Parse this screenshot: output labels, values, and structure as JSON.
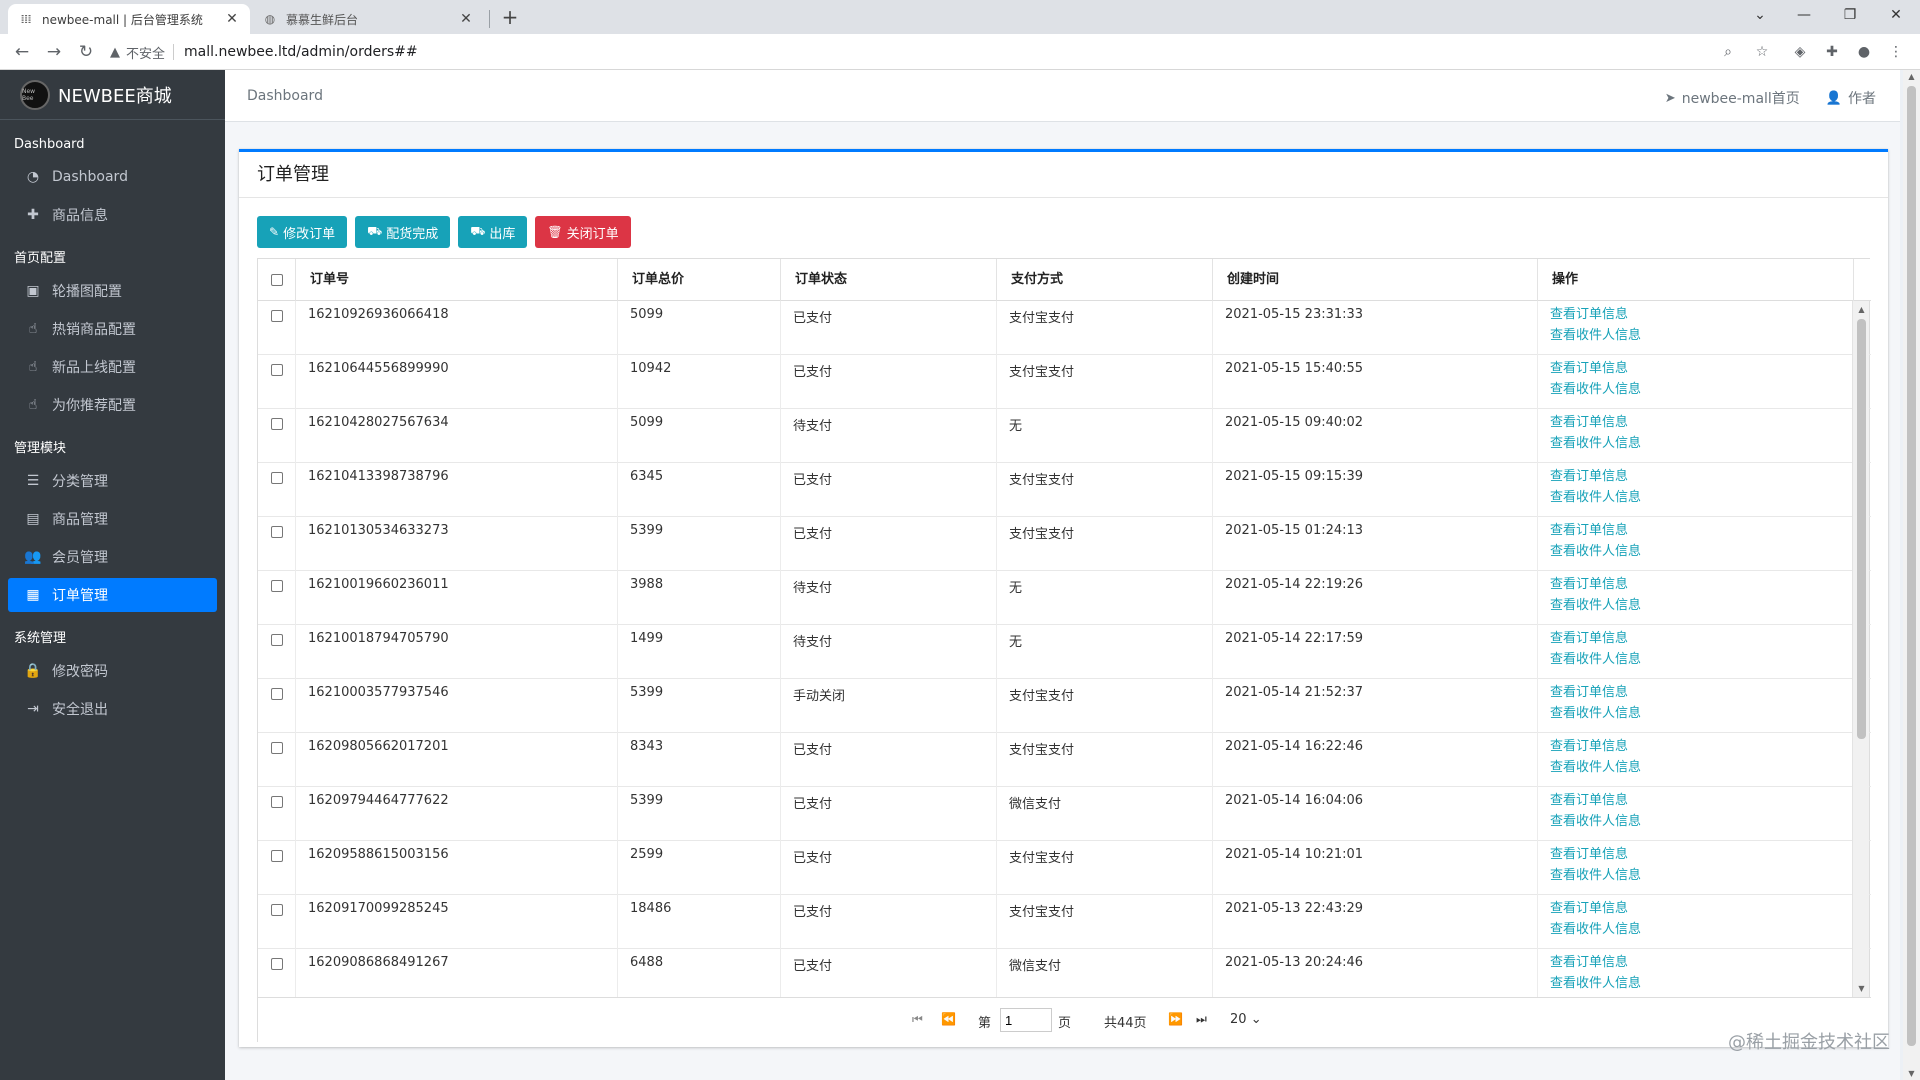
{
  "browser": {
    "tabs": [
      {
        "title": "newbee-mall | 后台管理系统",
        "icon": "favicon-icon",
        "active": true
      },
      {
        "title": "慕慕生鲜后台",
        "icon": "globe-icon",
        "active": false
      }
    ],
    "address": {
      "security_label": "不安全",
      "url": "mall.newbee.ltd/admin/orders##"
    }
  },
  "sidebar": {
    "brand": "NEWBEE商城",
    "logo_text": "New Bee",
    "groups": [
      {
        "header": "Dashboard",
        "items": [
          {
            "label": "Dashboard",
            "icon": "dashboard-icon"
          },
          {
            "label": "商品信息",
            "icon": "plus-icon"
          }
        ]
      },
      {
        "header": "首页配置",
        "items": [
          {
            "label": "轮播图配置",
            "icon": "image-icon"
          },
          {
            "label": "热销商品配置",
            "icon": "hand-pointer-icon"
          },
          {
            "label": "新品上线配置",
            "icon": "hand-pointer-icon"
          },
          {
            "label": "为你推荐配置",
            "icon": "hand-pointer-icon"
          }
        ]
      },
      {
        "header": "管理模块",
        "items": [
          {
            "label": "分类管理",
            "icon": "list-icon"
          },
          {
            "label": "商品管理",
            "icon": "box-icon"
          },
          {
            "label": "会员管理",
            "icon": "users-icon"
          },
          {
            "label": "订单管理",
            "icon": "money-icon",
            "active": true
          }
        ]
      },
      {
        "header": "系统管理",
        "items": [
          {
            "label": "修改密码",
            "icon": "lock-icon"
          },
          {
            "label": "安全退出",
            "icon": "sign-out-icon"
          }
        ]
      }
    ]
  },
  "topnav": {
    "breadcrumb": "Dashboard",
    "home_link": "newbee-mall首页",
    "author_link": "作者"
  },
  "card": {
    "title": "订单管理",
    "buttons": [
      {
        "label": "修改订单",
        "icon": "edit-icon",
        "color": "#17a2b8"
      },
      {
        "label": "配货完成",
        "icon": "truck-icon",
        "color": "#17a2b8"
      },
      {
        "label": "出库",
        "icon": "truck-icon",
        "color": "#17a2b8"
      },
      {
        "label": "关闭订单",
        "icon": "trash-icon",
        "color": "#dc3545"
      }
    ]
  },
  "table": {
    "headers": [
      "订单号",
      "订单总价",
      "订单状态",
      "支付方式",
      "创建时间",
      "操作"
    ],
    "link_view_order": "查看订单信息",
    "link_view_receiver": "查看收件人信息",
    "rows": [
      {
        "order_no": "16210926936066418",
        "total": "5099",
        "status": "已支付",
        "pay": "支付宝支付",
        "time": "2021-05-15 23:31:33"
      },
      {
        "order_no": "16210644556899990",
        "total": "10942",
        "status": "已支付",
        "pay": "支付宝支付",
        "time": "2021-05-15 15:40:55"
      },
      {
        "order_no": "16210428027567634",
        "total": "5099",
        "status": "待支付",
        "pay": "无",
        "time": "2021-05-15 09:40:02"
      },
      {
        "order_no": "16210413398738796",
        "total": "6345",
        "status": "已支付",
        "pay": "支付宝支付",
        "time": "2021-05-15 09:15:39"
      },
      {
        "order_no": "16210130534633273",
        "total": "5399",
        "status": "已支付",
        "pay": "支付宝支付",
        "time": "2021-05-15 01:24:13"
      },
      {
        "order_no": "16210019660236011",
        "total": "3988",
        "status": "待支付",
        "pay": "无",
        "time": "2021-05-14 22:19:26"
      },
      {
        "order_no": "16210018794705790",
        "total": "1499",
        "status": "待支付",
        "pay": "无",
        "time": "2021-05-14 22:17:59"
      },
      {
        "order_no": "16210003577937546",
        "total": "5399",
        "status": "手动关闭",
        "pay": "支付宝支付",
        "time": "2021-05-14 21:52:37"
      },
      {
        "order_no": "16209805662017201",
        "total": "8343",
        "status": "已支付",
        "pay": "支付宝支付",
        "time": "2021-05-14 16:22:46"
      },
      {
        "order_no": "16209794464777622",
        "total": "5399",
        "status": "已支付",
        "pay": "微信支付",
        "time": "2021-05-14 16:04:06"
      },
      {
        "order_no": "16209588615003156",
        "total": "2599",
        "status": "已支付",
        "pay": "支付宝支付",
        "time": "2021-05-14 10:21:01"
      },
      {
        "order_no": "16209170099285245",
        "total": "18486",
        "status": "已支付",
        "pay": "支付宝支付",
        "time": "2021-05-13 22:43:29"
      },
      {
        "order_no": "16209086868491267",
        "total": "6488",
        "status": "已支付",
        "pay": "微信支付",
        "time": "2021-05-13 20:24:46"
      }
    ]
  },
  "pager": {
    "page_prefix": "第",
    "page_value": "1",
    "page_suffix": "页",
    "total_pages": "共44页",
    "page_size": "20"
  },
  "watermark": "@稀土掘金技术社区",
  "colors": {
    "accent": "#007bff",
    "info": "#17a2b8",
    "danger": "#dc3545",
    "sidebar": "#343a40"
  }
}
